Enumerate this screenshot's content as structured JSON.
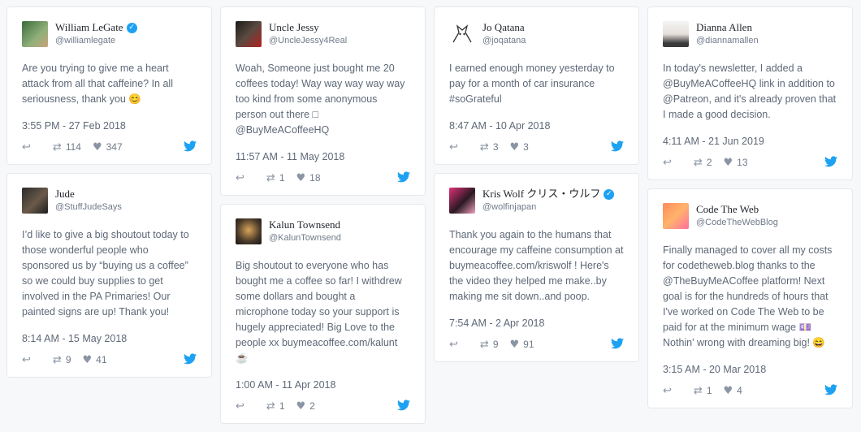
{
  "colors": {
    "twitter_blue": "#1da1f2",
    "background": "#f7f8fa"
  },
  "icons": {
    "reply": "reply-icon",
    "retweet": "retweet-icon",
    "like": "heart-icon",
    "verified": "verified-badge-icon",
    "brand": "twitter-bird-icon"
  },
  "tweets": [
    {
      "name": "William LeGate",
      "handle": "@williamlegate",
      "verified": true,
      "text": "Are you trying to give me a heart attack from all that caffeine? In all seriousness, thank you 😊",
      "time": "3:55 PM - 27 Feb 2018",
      "retweets": "114",
      "likes": "347"
    },
    {
      "name": "Jude",
      "handle": "@StuffJudeSays",
      "verified": false,
      "text": "I’d like to give a big shoutout today to those wonderful people who sponsored us by “buying us a coffee” so we could buy supplies to get involved in the PA Primaries! Our painted signs are up! Thank you!",
      "time": "8:14 AM - 15 May 2018",
      "retweets": "9",
      "likes": "41"
    },
    {
      "name": "Uncle Jessy",
      "handle": "@UncleJessy4Real",
      "verified": false,
      "text": "Woah, Someone just bought me 20 coffees today! Way way way way way too kind from some anonymous person out there □ @BuyMeACoffeeHQ",
      "time": "11:57 AM - 11 May 2018",
      "retweets": "1",
      "likes": "18"
    },
    {
      "name": "Kalun Townsend",
      "handle": "@KalunTownsend",
      "verified": false,
      "text": "Big shoutout to everyone who has bought me a coffee so far! I withdrew some dollars and bought a microphone today so your support is hugely appreciated! Big Love to the people xx buymeacoffee.com/kalunt ☕",
      "time": "1:00 AM - 11 Apr 2018",
      "retweets": "1",
      "likes": "2"
    },
    {
      "name": "Jo Qatana",
      "handle": "@joqatana",
      "verified": false,
      "text": "I earned enough money yesterday to pay for a month of car insurance #soGrateful",
      "time": "8:47 AM - 10 Apr 2018",
      "retweets": "3",
      "likes": "3"
    },
    {
      "name": "Kris Wolf クリス・ウルフ",
      "handle": "@wolfinjapan",
      "verified": true,
      "text": "Thank you again to the humans that encourage my caffeine consumption at buymeacoffee.com/kriswolf ! Here's the video they helped me make..by making me sit down..and poop.",
      "time": "7:54 AM - 2 Apr 2018",
      "retweets": "9",
      "likes": "91"
    },
    {
      "name": "Dianna Allen",
      "handle": "@diannamallen",
      "verified": false,
      "text": "In today's newsletter, I added a @BuyMeACoffeeHQ link in addition to @Patreon, and it's already proven that I made a good decision.",
      "time": "4:11 AM - 21 Jun 2019",
      "retweets": "2",
      "likes": "13"
    },
    {
      "name": "Code The Web",
      "handle": "@CodeTheWebBlog",
      "verified": false,
      "text": "Finally managed to cover all my costs for codetheweb.blog thanks to the @TheBuyMeACoffee platform! Next goal is for the hundreds of hours that I've worked on Code The Web to be paid for at the minimum wage 💷 Nothin' wrong with dreaming big! 😄",
      "time": "3:15 AM - 20 Mar 2018",
      "retweets": "1",
      "likes": "4"
    }
  ]
}
